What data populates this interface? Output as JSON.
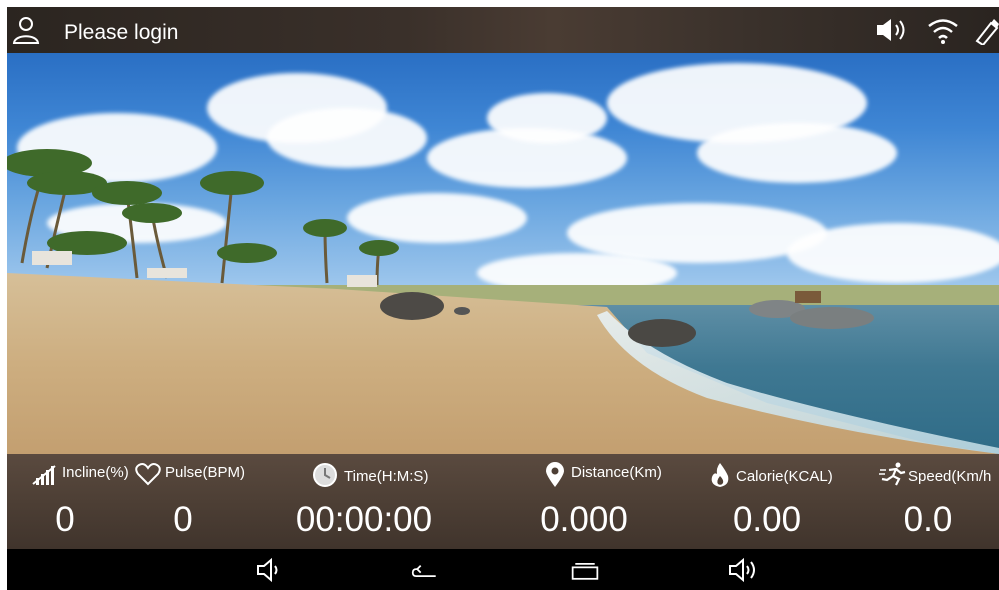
{
  "topbar": {
    "login_text": "Please login",
    "icons": [
      "user-icon",
      "volume-icon",
      "wifi-icon",
      "usb-icon"
    ]
  },
  "metrics": [
    {
      "key": "incline",
      "label": "Incline(%)",
      "value": "0",
      "icon": "incline-icon"
    },
    {
      "key": "pulse",
      "label": "Pulse(BPM)",
      "value": "0",
      "icon": "heart-icon"
    },
    {
      "key": "time",
      "label": "Time(H:M:S)",
      "value": "00:00:00",
      "icon": "clock-icon"
    },
    {
      "key": "distance",
      "label": "Distance(Km)",
      "value": "0.000",
      "icon": "location-pin-icon"
    },
    {
      "key": "calorie",
      "label": "Calorie(KCAL)",
      "value": "0.00",
      "icon": "flame-icon"
    },
    {
      "key": "speed",
      "label": "Speed(Km/h",
      "value": "0.0",
      "icon": "runner-icon"
    }
  ],
  "navbar": {
    "icons": [
      "volume-down-icon",
      "back-icon",
      "recent-apps-icon",
      "volume-up-icon"
    ]
  },
  "colors": {
    "metrics_bg": "#4d3f35",
    "text": "#ffffff",
    "navbar_bg": "#000000"
  }
}
